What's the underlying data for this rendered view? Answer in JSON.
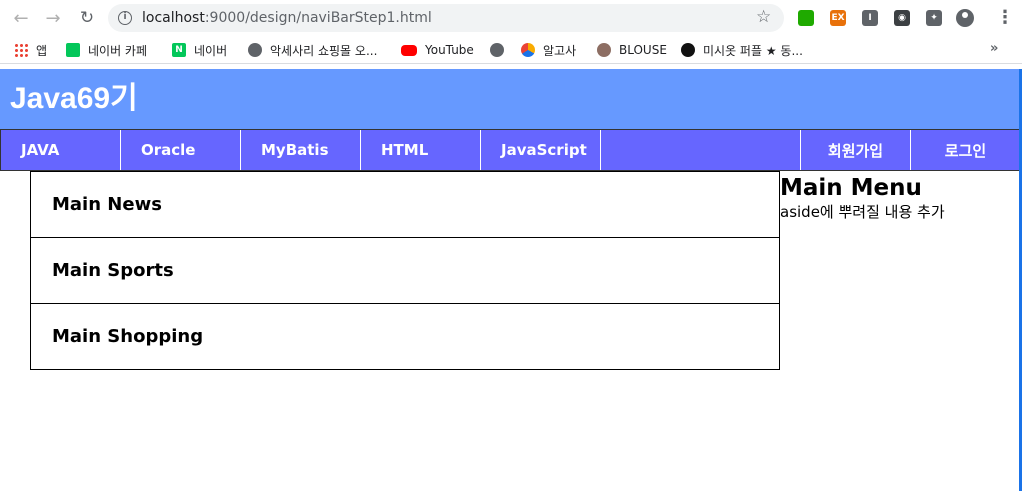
{
  "browser": {
    "url_host": "localhost",
    "url_path": ":9000/design/naviBarStep1.html",
    "back_glyph": "←",
    "forward_glyph": "→",
    "reload_glyph": "↻",
    "star_glyph": "☆",
    "menu_glyph": "⋮",
    "extensions": [
      {
        "icon": "green-screen-icon",
        "color": "#1faa00",
        "label": ""
      },
      {
        "icon": "ex-icon",
        "color": "#e8710a",
        "label": "EX"
      },
      {
        "icon": "info-ext-icon",
        "color": "#5f6368",
        "label": "I"
      },
      {
        "icon": "shield-ext-icon",
        "color": "#3c4043",
        "label": "◉"
      },
      {
        "icon": "puzzle-icon",
        "color": "#5f6368",
        "label": "✦"
      }
    ]
  },
  "bookmarks": {
    "items": [
      {
        "label": "앱",
        "icon": "apps-grid-icon"
      },
      {
        "label": "네이버 카페",
        "icon": "naver-cafe-icon"
      },
      {
        "label": "네이버",
        "icon": "naver-icon"
      },
      {
        "label": "악세사리 쇼핑몰 오...",
        "icon": "globe-icon"
      },
      {
        "label": "YouTube",
        "icon": "youtube-icon"
      },
      {
        "label": "",
        "icon": "globe-icon"
      },
      {
        "label": "알고사",
        "icon": "algo-icon"
      },
      {
        "label": "BLOUSE",
        "icon": "blouse-icon"
      },
      {
        "label": "미시옷 퍼플 ★ 동...",
        "icon": "misiot-icon"
      }
    ],
    "more_glyph": "»"
  },
  "site": {
    "title": "Java69기",
    "nav": [
      "JAVA",
      "Oracle",
      "MyBatis",
      "HTML",
      "JavaScript"
    ],
    "nav_right": [
      "회원가입",
      "로그인"
    ],
    "news": [
      "Main News",
      "Main Sports",
      "Main Shopping"
    ],
    "aside_title": "Main Menu",
    "aside_text": "aside에 뿌려질 내용 추가"
  },
  "colors": {
    "header_bg": "#6699ff",
    "nav_bg": "#6666ff",
    "text_on_nav": "#ffffff"
  }
}
